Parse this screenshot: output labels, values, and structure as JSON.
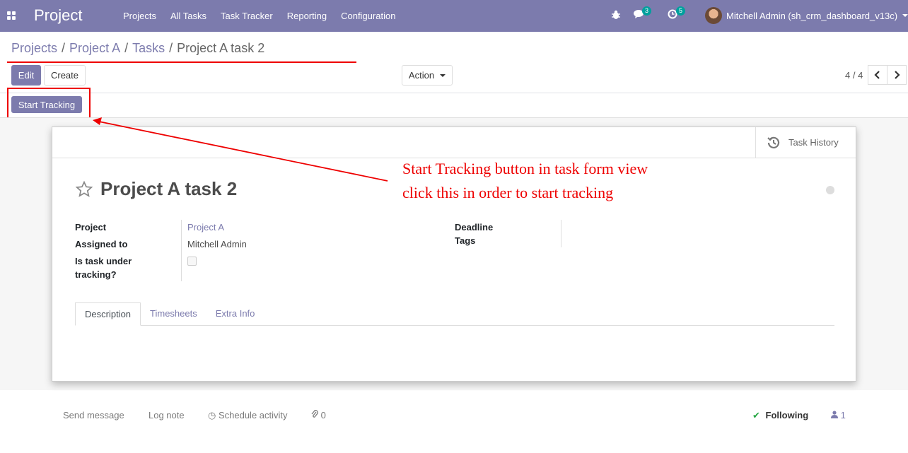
{
  "navbar": {
    "brand": "Project",
    "menu": [
      "Projects",
      "All Tasks",
      "Task Tracker",
      "Reporting",
      "Configuration"
    ],
    "messages_count": "3",
    "activities_count": "5",
    "user": "Mitchell Admin (sh_crm_dashboard_v13c)"
  },
  "breadcrumb": {
    "items": [
      "Projects",
      "Project A",
      "Tasks"
    ],
    "current": "Project A task 2"
  },
  "controls": {
    "edit": "Edit",
    "create": "Create",
    "action": "Action",
    "pager": "4 / 4"
  },
  "statusbar": {
    "start_tracking": "Start Tracking"
  },
  "sheet": {
    "task_history": "Task History",
    "title": "Project A task 2",
    "fields": {
      "project_label": "Project",
      "project_value": "Project A",
      "assigned_label": "Assigned to",
      "assigned_value": "Mitchell Admin",
      "tracking_label_1": "Is task under",
      "tracking_label_2": "tracking?",
      "deadline_label": "Deadline",
      "tags_label": "Tags"
    },
    "tabs": [
      "Description",
      "Timesheets",
      "Extra Info"
    ]
  },
  "annotation": {
    "line1": "Start Tracking button in task form view",
    "line2": "click this in order to start tracking"
  },
  "chatter": {
    "send_message": "Send message",
    "log_note": "Log note",
    "schedule_activity": "Schedule activity",
    "attachments": "0",
    "following": "Following",
    "followers": "1"
  },
  "colors": {
    "primary": "#7c7bad",
    "annotation": "#e00000",
    "badge": "#00a09d"
  }
}
